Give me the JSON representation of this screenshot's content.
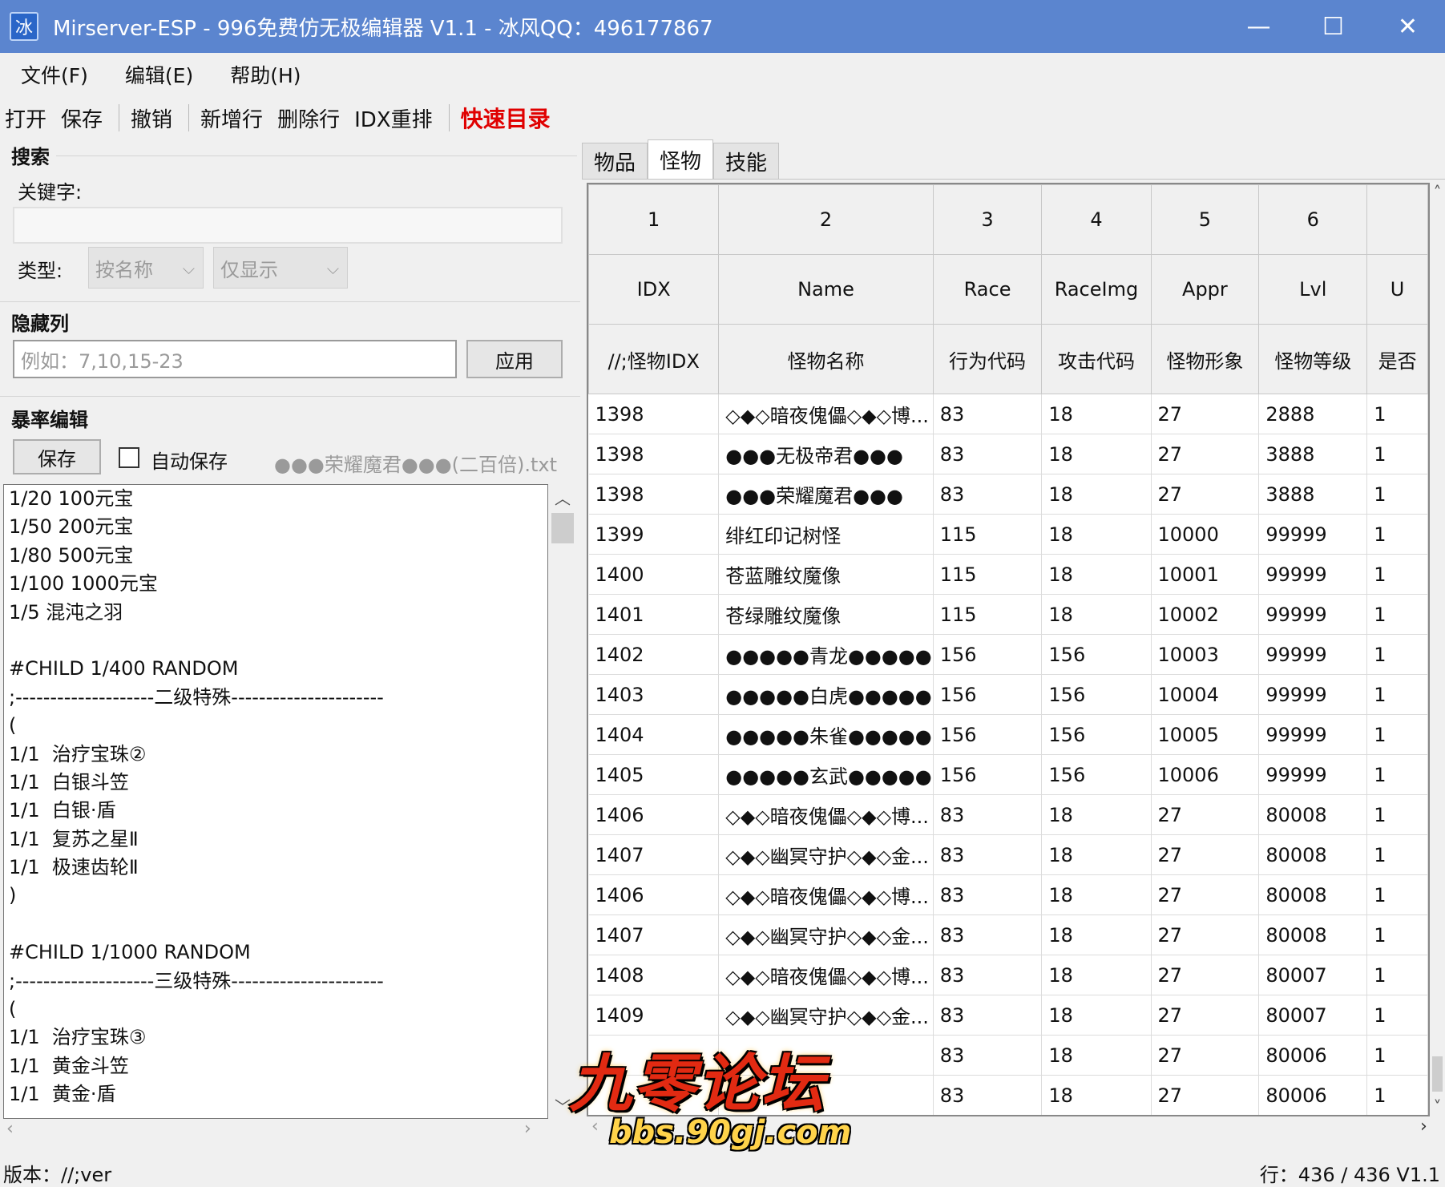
{
  "window": {
    "title": "Mirserver-ESP - 996免费仿无极编辑器 V1.1 - 冰风QQ：496177867",
    "icon_char": "冰",
    "minimize_glyph": "—",
    "maximize_glyph": "☐",
    "close_glyph": "✕"
  },
  "menu": [
    "文件(F)",
    "编辑(E)",
    "帮助(H)"
  ],
  "toolbar": {
    "open": "打开",
    "save": "保存",
    "undo": "撤销",
    "add_row": "新增行",
    "delete_row": "删除行",
    "idx_reorder": "IDX重排",
    "quick_dir": "快速目录"
  },
  "search": {
    "group_title": "搜索",
    "keyword_label": "关键字:",
    "keyword_value": "",
    "type_label": "类型:",
    "type_select": "按名称",
    "mode_select": "仅显示"
  },
  "hidden_cols": {
    "group_title": "隐藏列",
    "placeholder": "例如：7,10,15-23",
    "apply_label": "应用"
  },
  "drop_edit": {
    "group_title": "暴率编辑",
    "save_label": "保存",
    "auto_save_label": "自动保存",
    "auto_save_checked": false,
    "filename": "●●●荣耀魔君●●●(二百倍).txt",
    "lines": [
      "1/20 100元宝",
      "1/50 200元宝",
      "1/80 500元宝",
      "1/100 1000元宝",
      "1/5 混沌之羽",
      "",
      "#CHILD 1/400 RANDOM",
      ";--------------------二级特殊----------------------",
      "(",
      "1/1  治疗宝珠②",
      "1/1  白银斗笠",
      "1/1  白银·盾",
      "1/1  复苏之星Ⅱ",
      "1/1  极速齿轮Ⅱ",
      ")",
      "",
      "#CHILD 1/1000 RANDOM",
      ";--------------------三级特殊----------------------",
      "(",
      "1/1  治疗宝珠③",
      "1/1  黄金斗笠",
      "1/1  黄金·盾"
    ]
  },
  "tabs": [
    "物品",
    "怪物",
    "技能"
  ],
  "active_tab": "怪物",
  "grid": {
    "col_numbers": [
      "1",
      "2",
      "3",
      "4",
      "5",
      "6",
      ""
    ],
    "col_fields": [
      "IDX",
      "Name",
      "Race",
      "RaceImg",
      "Appr",
      "Lvl",
      "U"
    ],
    "col_desc": [
      "//;怪物IDX",
      "怪物名称",
      "行为代码",
      "攻击代码",
      "怪物形象",
      "怪物等级",
      "是否"
    ],
    "rows": [
      [
        "1398",
        "◇◆◇暗夜傀儡◇◆◇博...",
        "83",
        "18",
        "27",
        "2888",
        "1"
      ],
      [
        "1398",
        "●●●无极帝君●●●",
        "83",
        "18",
        "27",
        "3888",
        "1"
      ],
      [
        "1398",
        "●●●荣耀魔君●●●",
        "83",
        "18",
        "27",
        "3888",
        "1"
      ],
      [
        "1399",
        "绯红印记树怪",
        "115",
        "18",
        "10000",
        "99999",
        "1"
      ],
      [
        "1400",
        "苍蓝雕纹魔像",
        "115",
        "18",
        "10001",
        "99999",
        "1"
      ],
      [
        "1401",
        "苍绿雕纹魔像",
        "115",
        "18",
        "10002",
        "99999",
        "1"
      ],
      [
        "1402",
        "●●●●●青龙●●●●●",
        "156",
        "156",
        "10003",
        "99999",
        "1"
      ],
      [
        "1403",
        "●●●●●白虎●●●●●",
        "156",
        "156",
        "10004",
        "99999",
        "1"
      ],
      [
        "1404",
        "●●●●●朱雀●●●●●",
        "156",
        "156",
        "10005",
        "99999",
        "1"
      ],
      [
        "1405",
        "●●●●●玄武●●●●●",
        "156",
        "156",
        "10006",
        "99999",
        "1"
      ],
      [
        "1406",
        "◇◆◇暗夜傀儡◇◆◇博...",
        "83",
        "18",
        "27",
        "80008",
        "1"
      ],
      [
        "1407",
        "◇◆◇幽冥守护◇◆◇金...",
        "83",
        "18",
        "27",
        "80008",
        "1"
      ],
      [
        "1406",
        "◇◆◇暗夜傀儡◇◆◇博...",
        "83",
        "18",
        "27",
        "80008",
        "1"
      ],
      [
        "1407",
        "◇◆◇幽冥守护◇◆◇金...",
        "83",
        "18",
        "27",
        "80008",
        "1"
      ],
      [
        "1408",
        "◇◆◇暗夜傀儡◇◆◇博...",
        "83",
        "18",
        "27",
        "80007",
        "1"
      ],
      [
        "1409",
        "◇◆◇幽冥守护◇◆◇金...",
        "83",
        "18",
        "27",
        "80007",
        "1"
      ],
      [
        "",
        "",
        "83",
        "18",
        "27",
        "80006",
        "1"
      ],
      [
        "",
        "",
        "83",
        "18",
        "27",
        "80006",
        "1"
      ]
    ]
  },
  "status": {
    "version": "版本：//;ver",
    "rows": "行：436 / 436  V1.1"
  },
  "watermark": {
    "title": "九零论坛",
    "url": "bbs.90gj.com"
  }
}
